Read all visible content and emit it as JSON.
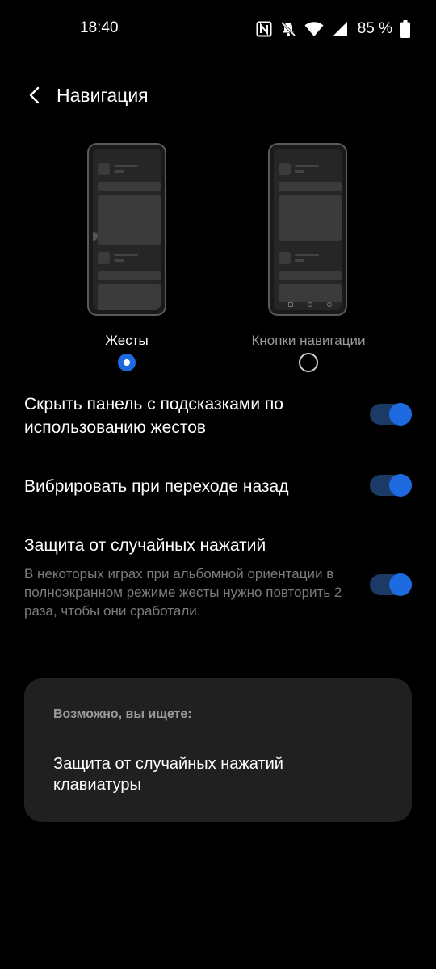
{
  "status_bar": {
    "time": "18:40",
    "battery_percent": "85 %",
    "icons": [
      "nfc-icon",
      "notifications-off-icon",
      "wifi-icon",
      "signal-icon",
      "battery-icon"
    ]
  },
  "header": {
    "back_icon": "chevron-left-icon",
    "title": "Навигация"
  },
  "navigation_modes": [
    {
      "label": "Жесты",
      "selected": true
    },
    {
      "label": "Кнопки навигации",
      "selected": false
    }
  ],
  "settings": [
    {
      "title": "Скрыть панель с подсказками по использованию жестов",
      "enabled": true
    },
    {
      "title": "Вибрировать при переходе назад",
      "enabled": true
    },
    {
      "title": "Защита от случайных нажатий",
      "description": "В некоторых играх при альбомной ориентации в полноэкранном режиме жесты нужно повторить 2 раза, чтобы они сработали.",
      "enabled": true
    }
  ],
  "suggestions": {
    "heading": "Возможно, вы ищете:",
    "items": [
      "Защита от случайных нажатий клавиатуры"
    ]
  },
  "colors": {
    "accent": "#1e6ae0",
    "toggle_track": "#1c3a66",
    "card_background": "#202020",
    "background": "#000000"
  }
}
